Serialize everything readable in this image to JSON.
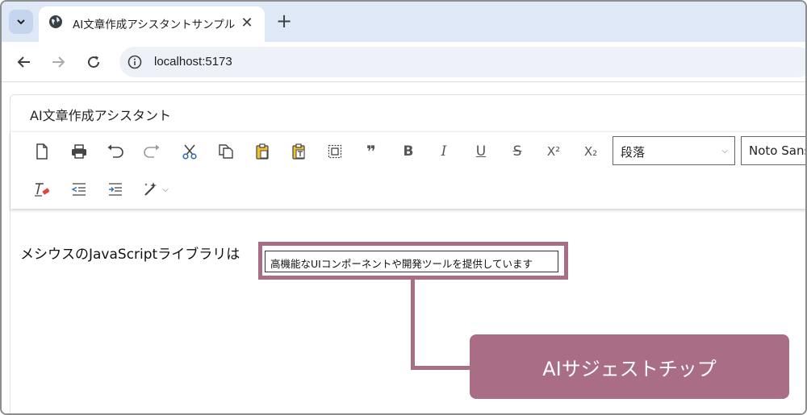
{
  "browser": {
    "tab_title": "AI文章作成アシスタントサンプル",
    "close_glyph": "✕",
    "newtab_glyph": "+",
    "url": "localhost:5173"
  },
  "editor": {
    "title": "AI文章作成アシスタント",
    "toolbar": {
      "bold": "B",
      "italic": "I",
      "underline": "U",
      "strikethrough": "S",
      "superscript": "X²",
      "subscript": "X₂",
      "quote": "❞",
      "format_select": "段落",
      "font_select": "Noto Sans"
    },
    "content_text": "メシウスのJavaScriptライブラリは",
    "suggestion_chip": "高機能なUIコンポーネントや開発ツールを提供しています"
  },
  "annotation": {
    "callout_label": "AIサジェストチップ",
    "color": "#a96d85"
  }
}
